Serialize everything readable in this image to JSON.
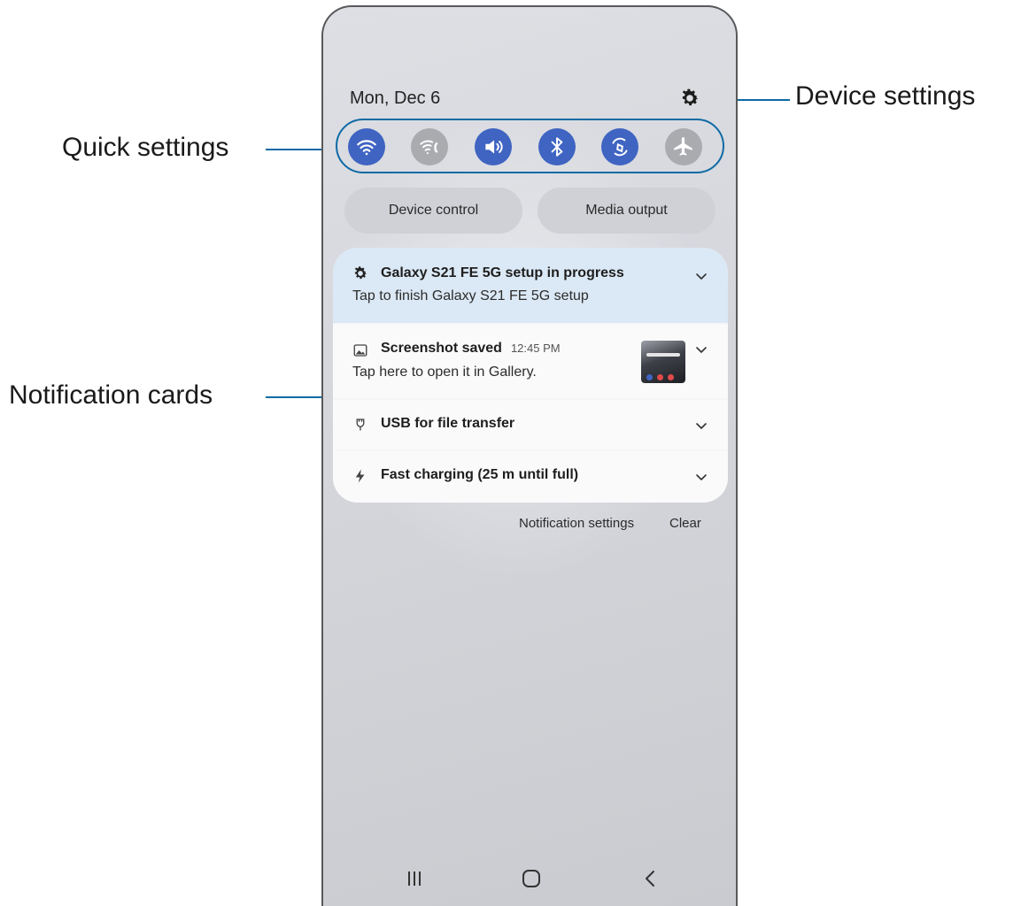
{
  "callouts": {
    "device_settings": "Device settings",
    "quick_settings": "Quick settings",
    "notification_cards": "Notification cards"
  },
  "panel": {
    "date": "Mon, Dec 6",
    "settings_icon": "gear-icon"
  },
  "quick_settings": [
    {
      "name": "wifi-icon",
      "state": "on"
    },
    {
      "name": "wifi-calling-icon",
      "state": "off"
    },
    {
      "name": "sound-icon",
      "state": "on"
    },
    {
      "name": "bluetooth-icon",
      "state": "on"
    },
    {
      "name": "auto-rotate-icon",
      "state": "on"
    },
    {
      "name": "airplane-icon",
      "state": "off"
    }
  ],
  "buttons": {
    "device_control": "Device control",
    "media_output": "Media output"
  },
  "notifications": {
    "setup": {
      "title": "Galaxy S21 FE 5G setup in progress",
      "text": "Tap to finish Galaxy S21 FE 5G setup"
    },
    "screenshot": {
      "title": "Screenshot saved",
      "time": "12:45 PM",
      "text": "Tap here to open it in Gallery."
    },
    "usb": {
      "title": "USB for file transfer"
    },
    "charging": {
      "title": "Fast charging (25 m until full)"
    }
  },
  "footer": {
    "notification_settings": "Notification settings",
    "clear": "Clear"
  },
  "navbar": [
    "recents-icon",
    "home-icon",
    "back-icon"
  ],
  "colors": {
    "accent": "#0e6aa5",
    "toggle_on": "#3f64c2",
    "toggle_off": "#a9abaf",
    "setup_card": "#dbe8f5"
  }
}
